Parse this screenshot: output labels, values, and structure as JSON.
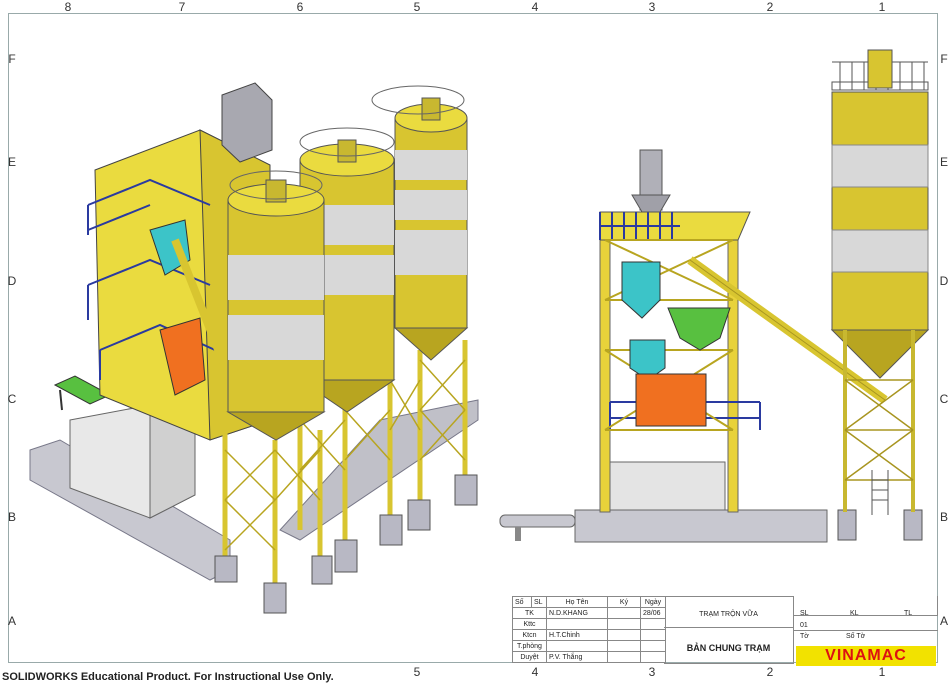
{
  "zones": {
    "top": [
      "8",
      "7",
      "6",
      "5",
      "4",
      "3",
      "2",
      "1"
    ],
    "bottom": [
      "5",
      "4",
      "3",
      "2",
      "1"
    ],
    "left": [
      "F",
      "E",
      "D",
      "C",
      "B",
      "A"
    ],
    "right": [
      "F",
      "E",
      "D",
      "C",
      "B",
      "A"
    ]
  },
  "title_block": {
    "headers": [
      "Số",
      "SL",
      "Họ Tên",
      "Ký",
      "Ngày"
    ],
    "rows": [
      {
        "role": "TK",
        "name": "N.D.KHANG",
        "date": "28/06"
      },
      {
        "role": "Kttc",
        "name": "",
        "date": ""
      },
      {
        "role": "Ktcn",
        "name": "H.T.Chinh",
        "date": ""
      },
      {
        "role": "T.phòng",
        "name": "",
        "date": ""
      },
      {
        "role": "Duyệt",
        "name": "P.V. Thắng",
        "date": ""
      }
    ],
    "project": "TRẠM TRỘN VỮA",
    "drawing_title": "BẢN CHUNG TRẠM",
    "sl_label": "SL",
    "kl_label": "KL",
    "tl_label": "TL",
    "sl_value": "01",
    "to_label": "Tờ",
    "so_to_label": "Số Tờ"
  },
  "logo": {
    "part1": "VINA",
    "part2": "MAC"
  },
  "watermark": "SOLIDWORKS Educational Product. For Instructional Use Only.",
  "colors": {
    "yellow": "#e8d23a",
    "silo_band": "#d8d8d8",
    "rail": "#2a3aa0",
    "cyan": "#3cc4c8",
    "green": "#58c040",
    "orange": "#f07020",
    "grey": "#b8b8c0"
  }
}
